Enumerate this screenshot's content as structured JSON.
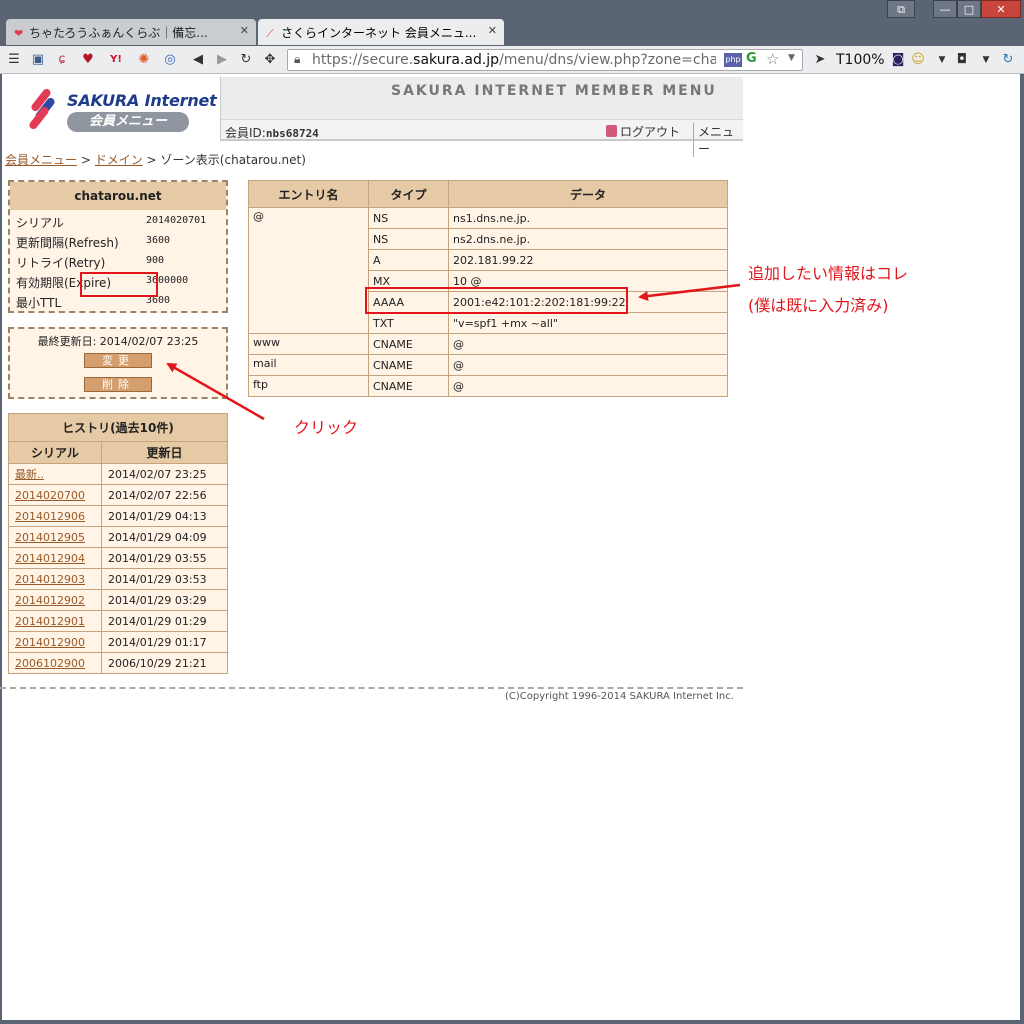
{
  "browser": {
    "tabs": [
      {
        "icon": "heart-icon",
        "title": "ちゃたろうふぁんくらぶ｜備忘...",
        "active": false
      },
      {
        "icon": "sakura-favicon-icon",
        "title": "さくらインターネット 会員メニュ...",
        "active": true
      }
    ],
    "url_prefix": "https://secure.",
    "url_domain": "sakura.ad.jp",
    "url_path": "/menu/dns/view.php?zone=chatar",
    "zoom": "T100%",
    "php_badge": "php",
    "g_badge": "G"
  },
  "header": {
    "logo_name": "SAKURA Internet",
    "logo_sub": "会員メニュー",
    "band_title": "SAKURA INTERNET MEMBER MENU",
    "member_label": "会員ID:",
    "member_id": "nbs68724",
    "logout": "ログアウト",
    "menu": "メニュー"
  },
  "breadcrumb": {
    "items": [
      "会員メニュー",
      "ドメイン"
    ],
    "separator": " > ",
    "current": "ゾーン表示(chatarou.net)"
  },
  "zone": {
    "domain": "chatarou.net",
    "rows": [
      {
        "key": "シリアル",
        "value": "2014020701"
      },
      {
        "key": "更新間隔(Refresh)",
        "value": "3600"
      },
      {
        "key": "リトライ(Retry)",
        "value": "900"
      },
      {
        "key": "有効期限(Expire)",
        "value": "3600000"
      },
      {
        "key": "最小TTL",
        "value": "3600"
      }
    ]
  },
  "update": {
    "last_updated": "最終更新日: 2014/02/07 23:25",
    "change_label": "変更",
    "delete_label": "削除"
  },
  "history": {
    "caption": "ヒストリ(過去10件)",
    "col_serial": "シリアル",
    "col_date": "更新日",
    "rows": [
      {
        "serial": "最新..",
        "date": "2014/02/07 23:25"
      },
      {
        "serial": "2014020700",
        "date": "2014/02/07 22:56"
      },
      {
        "serial": "2014012906",
        "date": "2014/01/29 04:13"
      },
      {
        "serial": "2014012905",
        "date": "2014/01/29 04:09"
      },
      {
        "serial": "2014012904",
        "date": "2014/01/29 03:55"
      },
      {
        "serial": "2014012903",
        "date": "2014/01/29 03:53"
      },
      {
        "serial": "2014012902",
        "date": "2014/01/29 03:29"
      },
      {
        "serial": "2014012901",
        "date": "2014/01/29 01:29"
      },
      {
        "serial": "2014012900",
        "date": "2014/01/29 01:17"
      },
      {
        "serial": "2006102900",
        "date": "2006/10/29 21:21"
      }
    ]
  },
  "dns": {
    "col_entry": "エントリ名",
    "col_type": "タイプ",
    "col_data": "データ",
    "groups": [
      {
        "entry": "@",
        "records": [
          {
            "type": "NS",
            "data": "ns1.dns.ne.jp."
          },
          {
            "type": "NS",
            "data": "ns2.dns.ne.jp."
          },
          {
            "type": "A",
            "data": "202.181.99.22"
          },
          {
            "type": "MX",
            "data": "10 @"
          },
          {
            "type": "AAAA",
            "data": "2001:e42:101:2:202:181:99:22"
          },
          {
            "type": "TXT",
            "data": "\"v=spf1 +mx ~all\""
          }
        ]
      },
      {
        "entry": "www",
        "records": [
          {
            "type": "CNAME",
            "data": "@"
          }
        ]
      },
      {
        "entry": "mail",
        "records": [
          {
            "type": "CNAME",
            "data": "@"
          }
        ]
      },
      {
        "entry": "ftp",
        "records": [
          {
            "type": "CNAME",
            "data": "@"
          }
        ]
      }
    ]
  },
  "footer": {
    "copyright": "(C)Copyright 1996-2014 SAKURA Internet Inc."
  },
  "annotations": {
    "info_line1": "追加したい情報はコレ",
    "info_line2": "(僕は既に入力済み)",
    "click": "クリック",
    "color": "#e2151b"
  }
}
